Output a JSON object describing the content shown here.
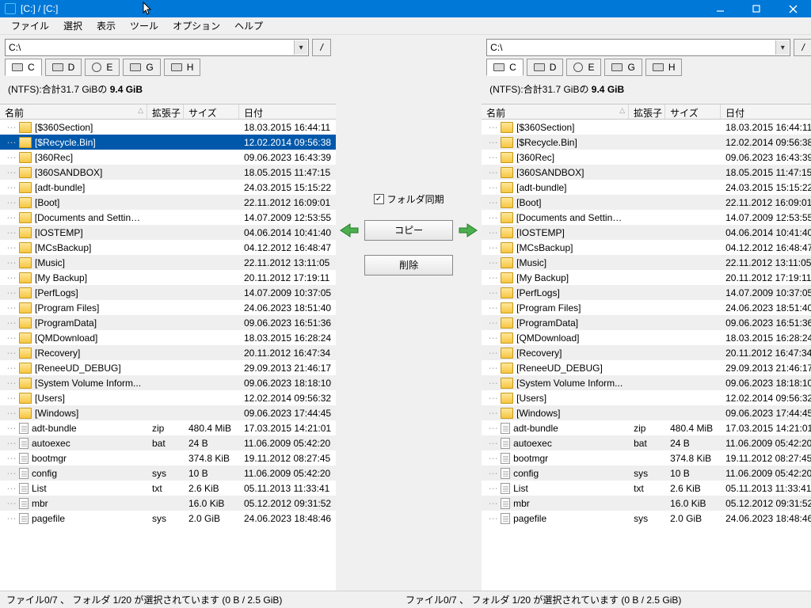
{
  "window": {
    "title": "[C:] / [C:]"
  },
  "menu": {
    "file": "ファイル",
    "select": "選択",
    "view": "表示",
    "tools": "ツール",
    "options": "オプション",
    "help": "ヘルプ"
  },
  "drives": {
    "c": "C",
    "d": "D",
    "e": "E",
    "g": "G",
    "h": "H"
  },
  "path": {
    "left": "C:\\",
    "right": "C:\\"
  },
  "diskinfo": {
    "prefix": "(NTFS):合計31.7 GiBの ",
    "free": "9.4 GiB"
  },
  "columns": {
    "name": "名前",
    "ext": "拡張子",
    "size": "サイズ",
    "date": "日付"
  },
  "status": {
    "left": "ファイル0/7 、 フォルダ 1/20 が選択されています (0 B / 2.5 GiB)",
    "right": "ファイル0/7 、 フォルダ 1/20 が選択されています (0 B / 2.5 GiB)"
  },
  "mid": {
    "sync": "フォルダ同期",
    "copy": "コピー",
    "delete": "削除"
  },
  "rows": [
    {
      "type": "folder",
      "name": "[$360Section]",
      "ext": "",
      "size": "",
      "date": "18.03.2015 16:44:11",
      "sel": false
    },
    {
      "type": "folder",
      "name": "[$Recycle.Bin]",
      "ext": "",
      "size": "",
      "date": "12.02.2014 09:56:38",
      "sel": true
    },
    {
      "type": "folder",
      "name": "[360Rec]",
      "ext": "",
      "size": "",
      "date": "09.06.2023 16:43:39",
      "sel": false
    },
    {
      "type": "folder",
      "name": "[360SANDBOX]",
      "ext": "",
      "size": "",
      "date": "18.05.2015 11:47:15",
      "sel": false
    },
    {
      "type": "folder",
      "name": "[adt-bundle]",
      "ext": "",
      "size": "",
      "date": "24.03.2015 15:15:22",
      "sel": false
    },
    {
      "type": "folder",
      "name": "[Boot]",
      "ext": "",
      "size": "",
      "date": "22.11.2012 16:09:01",
      "sel": false
    },
    {
      "type": "folder",
      "name": "[Documents and Settings]",
      "ext": "",
      "size": "",
      "date": "14.07.2009 12:53:55",
      "sel": false
    },
    {
      "type": "folder",
      "name": "[IOSTEMP]",
      "ext": "",
      "size": "",
      "date": "04.06.2014 10:41:40",
      "sel": false
    },
    {
      "type": "folder",
      "name": "[MCsBackup]",
      "ext": "",
      "size": "",
      "date": "04.12.2012 16:48:47",
      "sel": false
    },
    {
      "type": "folder",
      "name": "[Music]",
      "ext": "",
      "size": "",
      "date": "22.11.2012 13:11:05",
      "sel": false
    },
    {
      "type": "folder",
      "name": "[My Backup]",
      "ext": "",
      "size": "",
      "date": "20.11.2012 17:19:11",
      "sel": false
    },
    {
      "type": "folder",
      "name": "[PerfLogs]",
      "ext": "",
      "size": "",
      "date": "14.07.2009 10:37:05",
      "sel": false
    },
    {
      "type": "folder",
      "name": "[Program Files]",
      "ext": "",
      "size": "",
      "date": "24.06.2023 18:51:40",
      "sel": false
    },
    {
      "type": "folder",
      "name": "[ProgramData]",
      "ext": "",
      "size": "",
      "date": "09.06.2023 16:51:36",
      "sel": false
    },
    {
      "type": "folder",
      "name": "[QMDownload]",
      "ext": "",
      "size": "",
      "date": "18.03.2015 16:28:24",
      "sel": false
    },
    {
      "type": "folder",
      "name": "[Recovery]",
      "ext": "",
      "size": "",
      "date": "20.11.2012 16:47:34",
      "sel": false
    },
    {
      "type": "folder",
      "name": "[ReneeUD_DEBUG]",
      "ext": "",
      "size": "",
      "date": "29.09.2013 21:46:17",
      "sel": false
    },
    {
      "type": "folder",
      "name": "[System Volume Inform...",
      "ext": "",
      "size": "",
      "date": "09.06.2023 18:18:10",
      "sel": false
    },
    {
      "type": "folder",
      "name": "[Users]",
      "ext": "",
      "size": "",
      "date": "12.02.2014 09:56:32",
      "sel": false
    },
    {
      "type": "folder",
      "name": "[Windows]",
      "ext": "",
      "size": "",
      "date": "09.06.2023 17:44:45",
      "sel": false
    },
    {
      "type": "file",
      "name": "adt-bundle",
      "ext": "zip",
      "size": "480.4 MiB",
      "date": "17.03.2015 14:21:01",
      "sel": false
    },
    {
      "type": "file",
      "name": "autoexec",
      "ext": "bat",
      "size": "24 B",
      "date": "11.06.2009 05:42:20",
      "sel": false
    },
    {
      "type": "file",
      "name": "bootmgr",
      "ext": "",
      "size": "374.8 KiB",
      "date": "19.11.2012 08:27:45",
      "sel": false
    },
    {
      "type": "file",
      "name": "config",
      "ext": "sys",
      "size": "10 B",
      "date": "11.06.2009 05:42:20",
      "sel": false
    },
    {
      "type": "file",
      "name": "List",
      "ext": "txt",
      "size": "2.6 KiB",
      "date": "05.11.2013 11:33:41",
      "sel": false
    },
    {
      "type": "file",
      "name": "mbr",
      "ext": "",
      "size": "16.0 KiB",
      "date": "05.12.2012 09:31:52",
      "sel": false
    },
    {
      "type": "file",
      "name": "pagefile",
      "ext": "sys",
      "size": "2.0 GiB",
      "date": "24.06.2023 18:48:46",
      "sel": false
    }
  ]
}
